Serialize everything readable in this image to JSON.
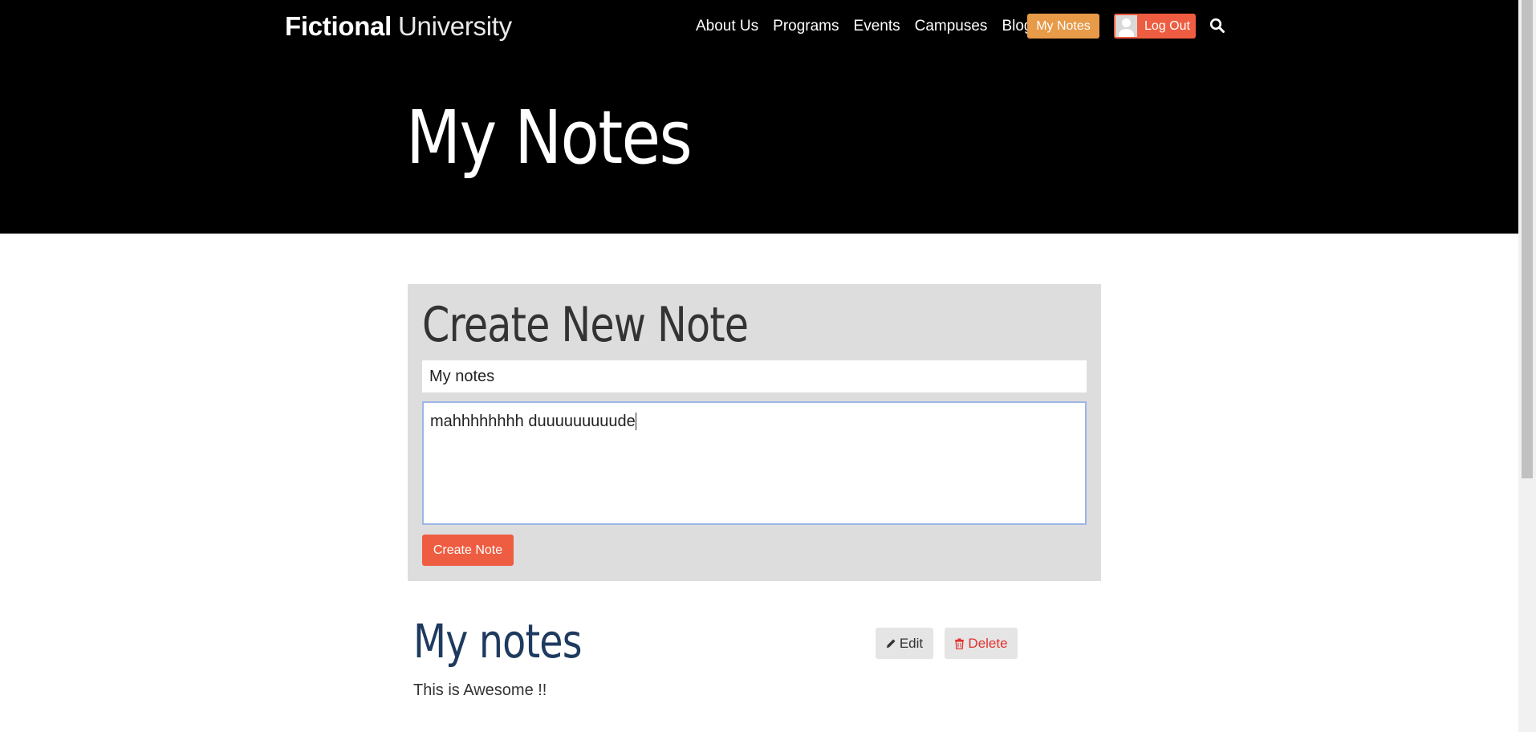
{
  "brand": {
    "part1": "Fictional",
    "part2": "University"
  },
  "nav": {
    "items": [
      "About Us",
      "Programs",
      "Events",
      "Campuses",
      "Blog"
    ],
    "my_notes_label": "My Notes",
    "logout_label": "Log Out"
  },
  "page": {
    "title": "My Notes"
  },
  "create_form": {
    "heading": "Create New Note",
    "title_value": "My notes",
    "body_value": "mahhhhhhhh duuuuuuuuude",
    "submit_label": "Create Note"
  },
  "notes": [
    {
      "title": "My notes",
      "body": "This is Awesome !!",
      "edit_label": "Edit",
      "delete_label": "Delete"
    }
  ],
  "colors": {
    "header_bg": "#000000",
    "accent_orange": "#e79a48",
    "accent_red": "#ee5d41",
    "panel_bg": "#dddddd",
    "note_title": "#1e3a5f"
  },
  "icons": [
    "user-avatar-icon",
    "search-icon",
    "pencil-icon",
    "trash-icon"
  ]
}
